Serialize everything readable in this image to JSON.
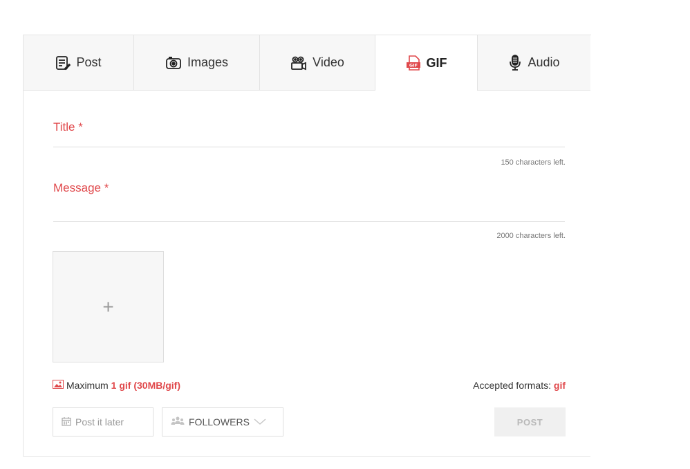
{
  "tabs": [
    {
      "label": "Post",
      "icon": "post-icon"
    },
    {
      "label": "Images",
      "icon": "camera-icon"
    },
    {
      "label": "Video",
      "icon": "video-camera-icon"
    },
    {
      "label": "GIF",
      "icon": "gif-file-icon"
    },
    {
      "label": "Audio",
      "icon": "microphone-icon"
    }
  ],
  "active_tab": "GIF",
  "form": {
    "title_label": "Title *",
    "title_value": "",
    "title_counter": "150 characters left.",
    "message_label": "Message *",
    "message_value": "",
    "message_counter": "2000 characters left."
  },
  "upload": {
    "plus": "+",
    "limit_prefix": "Maximum",
    "limit_value": "1 gif (30MB/gif)",
    "formats_prefix": "Accepted formats:",
    "formats_value": "gif"
  },
  "actions": {
    "post_later": "Post it later",
    "audience": "FOLLOWERS",
    "post": "POST"
  },
  "colors": {
    "accent": "#e0484b",
    "tabs_bg": "#f7f7f7",
    "border": "#e4e4e4"
  }
}
